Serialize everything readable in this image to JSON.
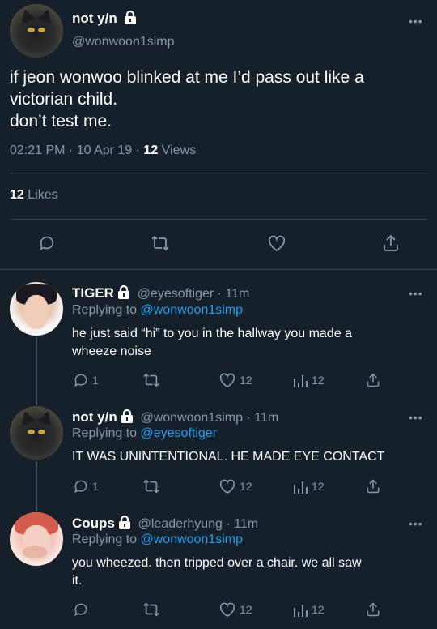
{
  "main_tweet": {
    "display_name": "not y/n",
    "handle": "@wonwoon1simp",
    "text_line1": "if jeon wonwoo blinked at me I’d pass out like a",
    "text_line2": "victorian child.",
    "text_line3": "don’t test me.",
    "time": "02:21 PM",
    "date": "10 Apr 19",
    "views_count": "12",
    "views_label": "Views",
    "likes_count": "12",
    "likes_label": "Likes",
    "more": "•••"
  },
  "replies": [
    {
      "display_name": "TIGER",
      "handle": "@eyesoftiger",
      "age": "11m",
      "replying_prefix": "Replying to",
      "replying_to": "@wonwoon1simp",
      "text_line1": "he just said “hi” to you in the hallway you made a",
      "text_line2": "wheeze noise",
      "reply_count": "1",
      "like_count": "12",
      "view_count": "12",
      "more": "•••"
    },
    {
      "display_name": "not y/n",
      "handle": "@wonwoon1simp",
      "age": "11m",
      "replying_prefix": "Replying to",
      "replying_to": "@eyesoftiger",
      "text_line1": "IT WAS UNINTENTIONAL. HE MADE EYE CONTACT",
      "reply_count": "1",
      "like_count": "12",
      "view_count": "12",
      "more": "•••"
    },
    {
      "display_name": "Coups",
      "handle": "@leaderhyung",
      "age": "11m",
      "replying_prefix": "Replying to",
      "replying_to": "@wonwoon1simp",
      "text_line1": "you wheezed. then tripped over a chair. we all saw",
      "text_line2": "it.",
      "like_count": "12",
      "view_count": "12",
      "more": "•••"
    }
  ],
  "colors": {
    "background": "#15202b",
    "secondary_text": "#8899a6",
    "link": "#1da1f2",
    "divider": "#38444d"
  },
  "icons": [
    "lock-icon",
    "reply-icon",
    "retweet-icon",
    "like-icon",
    "share-icon",
    "views-icon",
    "more-icon"
  ]
}
